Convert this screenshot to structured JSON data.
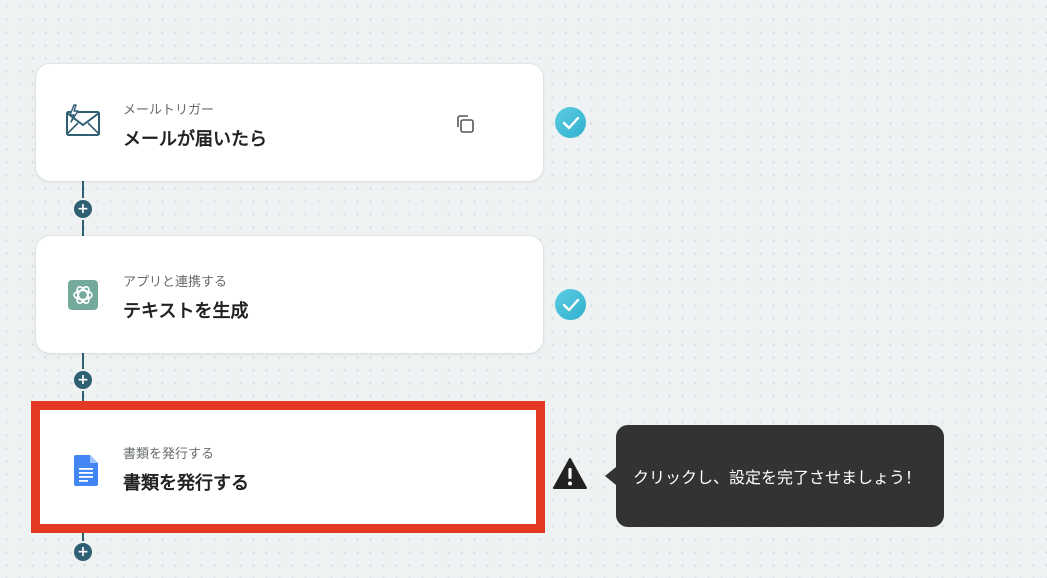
{
  "flow": {
    "steps": [
      {
        "subtitle": "メールトリガー",
        "title": "メールが届いたら",
        "icon": "mail-trigger-icon",
        "status": "completed"
      },
      {
        "subtitle": "アプリと連携する",
        "title": "テキストを生成",
        "icon": "openai-icon",
        "status": "completed"
      },
      {
        "subtitle": "書類を発行する",
        "title": "書類を発行する",
        "icon": "google-docs-icon",
        "status": "warning"
      }
    ],
    "add_label": "+"
  },
  "tooltip": {
    "text": "クリックし、設定を完了させましょう！"
  },
  "colors": {
    "connector": "#2e5f73",
    "check": "#3dbcd6",
    "highlight": "#e43a24",
    "tooltip_bg": "#333333",
    "docs_blue": "#4285f4",
    "openai_green": "#74aa9c"
  }
}
